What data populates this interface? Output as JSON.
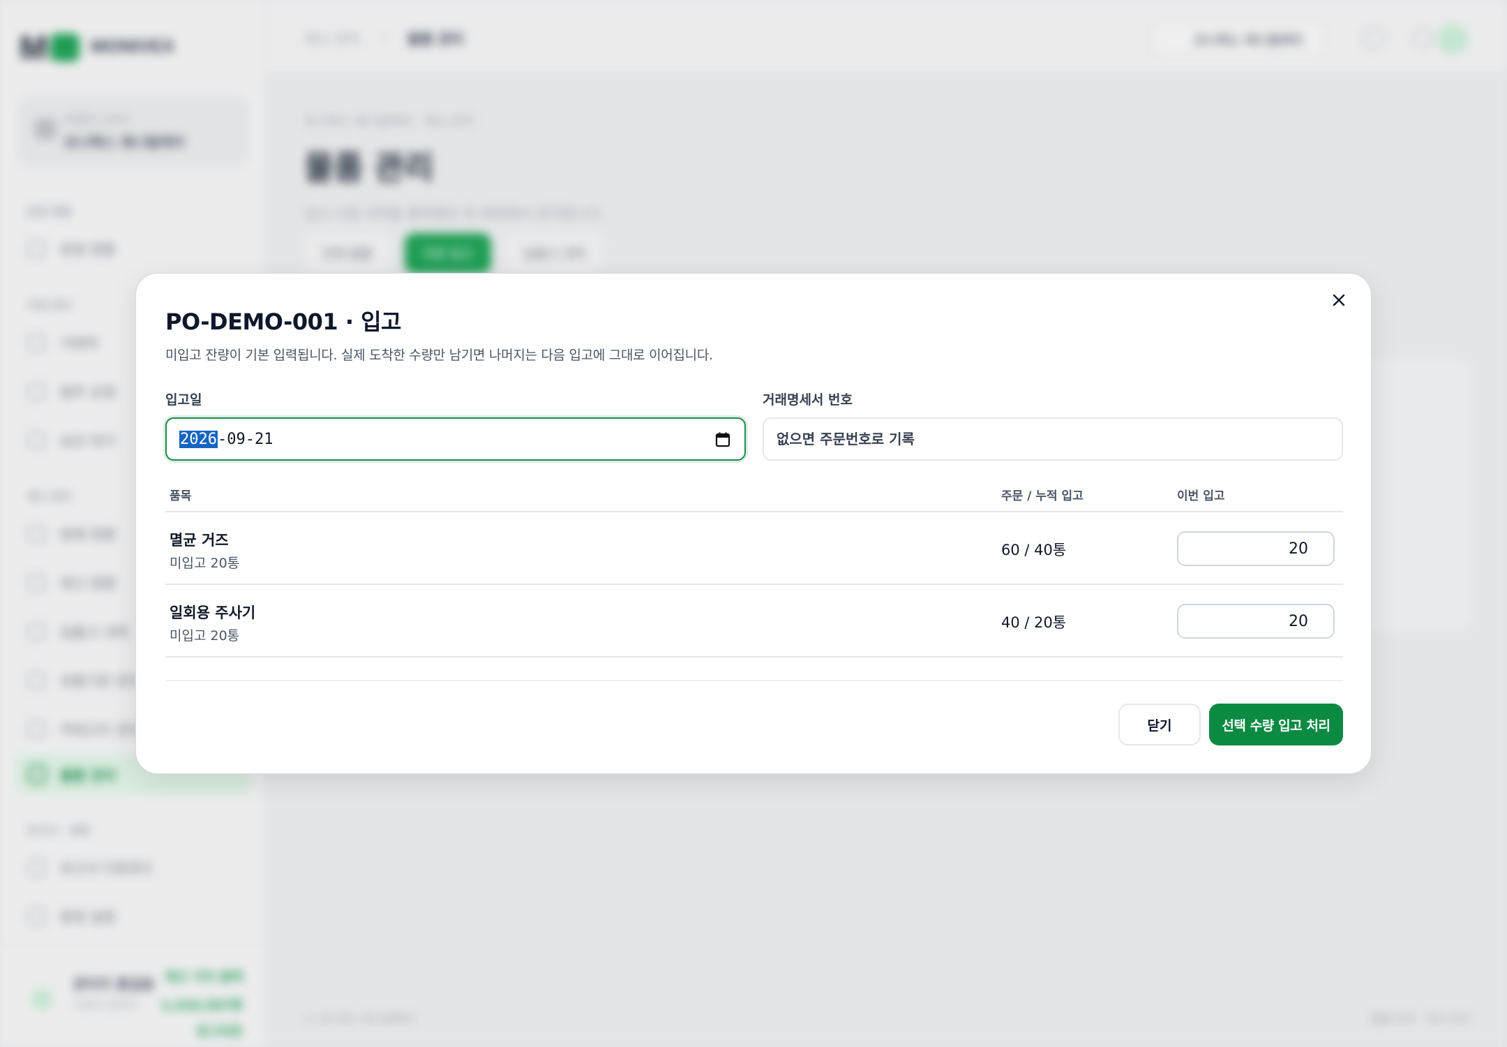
{
  "background": {
    "logo_text": "MONIVEX",
    "store_card": {
      "caption": "연결된 스토어",
      "name": "모니벡스 애니멀케어"
    },
    "sidebar_sections": [
      "운영 현황",
      "거래 관리",
      "재고 관리",
      "보고서 · 설정"
    ],
    "sidebar_items": [
      "운영 현황",
      "거래처",
      "발주 요청",
      "승인 대기",
      "판매 현황",
      "재고 현황",
      "입출고 내역",
      "유통기한 관리",
      "카테고리 관리",
      "물품 관리",
      "보고서 다운로드",
      "환경 설정"
    ],
    "footer_user": {
      "name": "관리자 홍길동",
      "role": "스토어 관리자"
    },
    "footer_stats": [
      "재고 가치 총액",
      "1,234,567원",
      "로그아웃"
    ],
    "breadcrumb": [
      "재고 관리",
      "물품 관리"
    ],
    "top_store": "모니벡스 애니멀케어",
    "page_kicker": "모니벡스 애니멀케어  ·  재고 관리",
    "page_title": "물품 관리",
    "page_desc": "입고·사용 내역을 품목별로 한 화면에서 관리합니다.",
    "tabs": [
      "전체 물품",
      "주문 입고",
      "입출고 내역"
    ],
    "tab_active_index": 1,
    "footer_left": "© 모니벡스 애니멀케어",
    "footer_right": "물품 관리 · 재고 관리"
  },
  "modal": {
    "title": "PO-DEMO-001 · 입고",
    "description": "미입고 잔량이 기본 입력됩니다. 실제 도착한 수량만 남기면 나머지는 다음 입고에 그대로 이어집니다.",
    "date_label": "입고일",
    "date_year_selected": "2026",
    "date_rest": "-09-21",
    "invoice_label": "거래명세서 번호",
    "invoice_placeholder": "없으면 주문번호로 기록",
    "table": {
      "headers": {
        "item": "품목",
        "ordered": "주문 / 누적 입고",
        "this_time": "이번 입고"
      },
      "rows": [
        {
          "name": "멸균 거즈",
          "remaining": "미입고 20통",
          "ordered_received": "60 / 40통",
          "input_value": "20"
        },
        {
          "name": "일회용 주사기",
          "remaining": "미입고 20통",
          "ordered_received": "40 / 20통",
          "input_value": "20"
        }
      ]
    },
    "buttons": {
      "close": "닫기",
      "submit": "선택 수량 입고 처리"
    }
  },
  "colors": {
    "accent": "#0b8a42",
    "focus_ring": "#1a8a4a",
    "selection": "#1565c0"
  }
}
